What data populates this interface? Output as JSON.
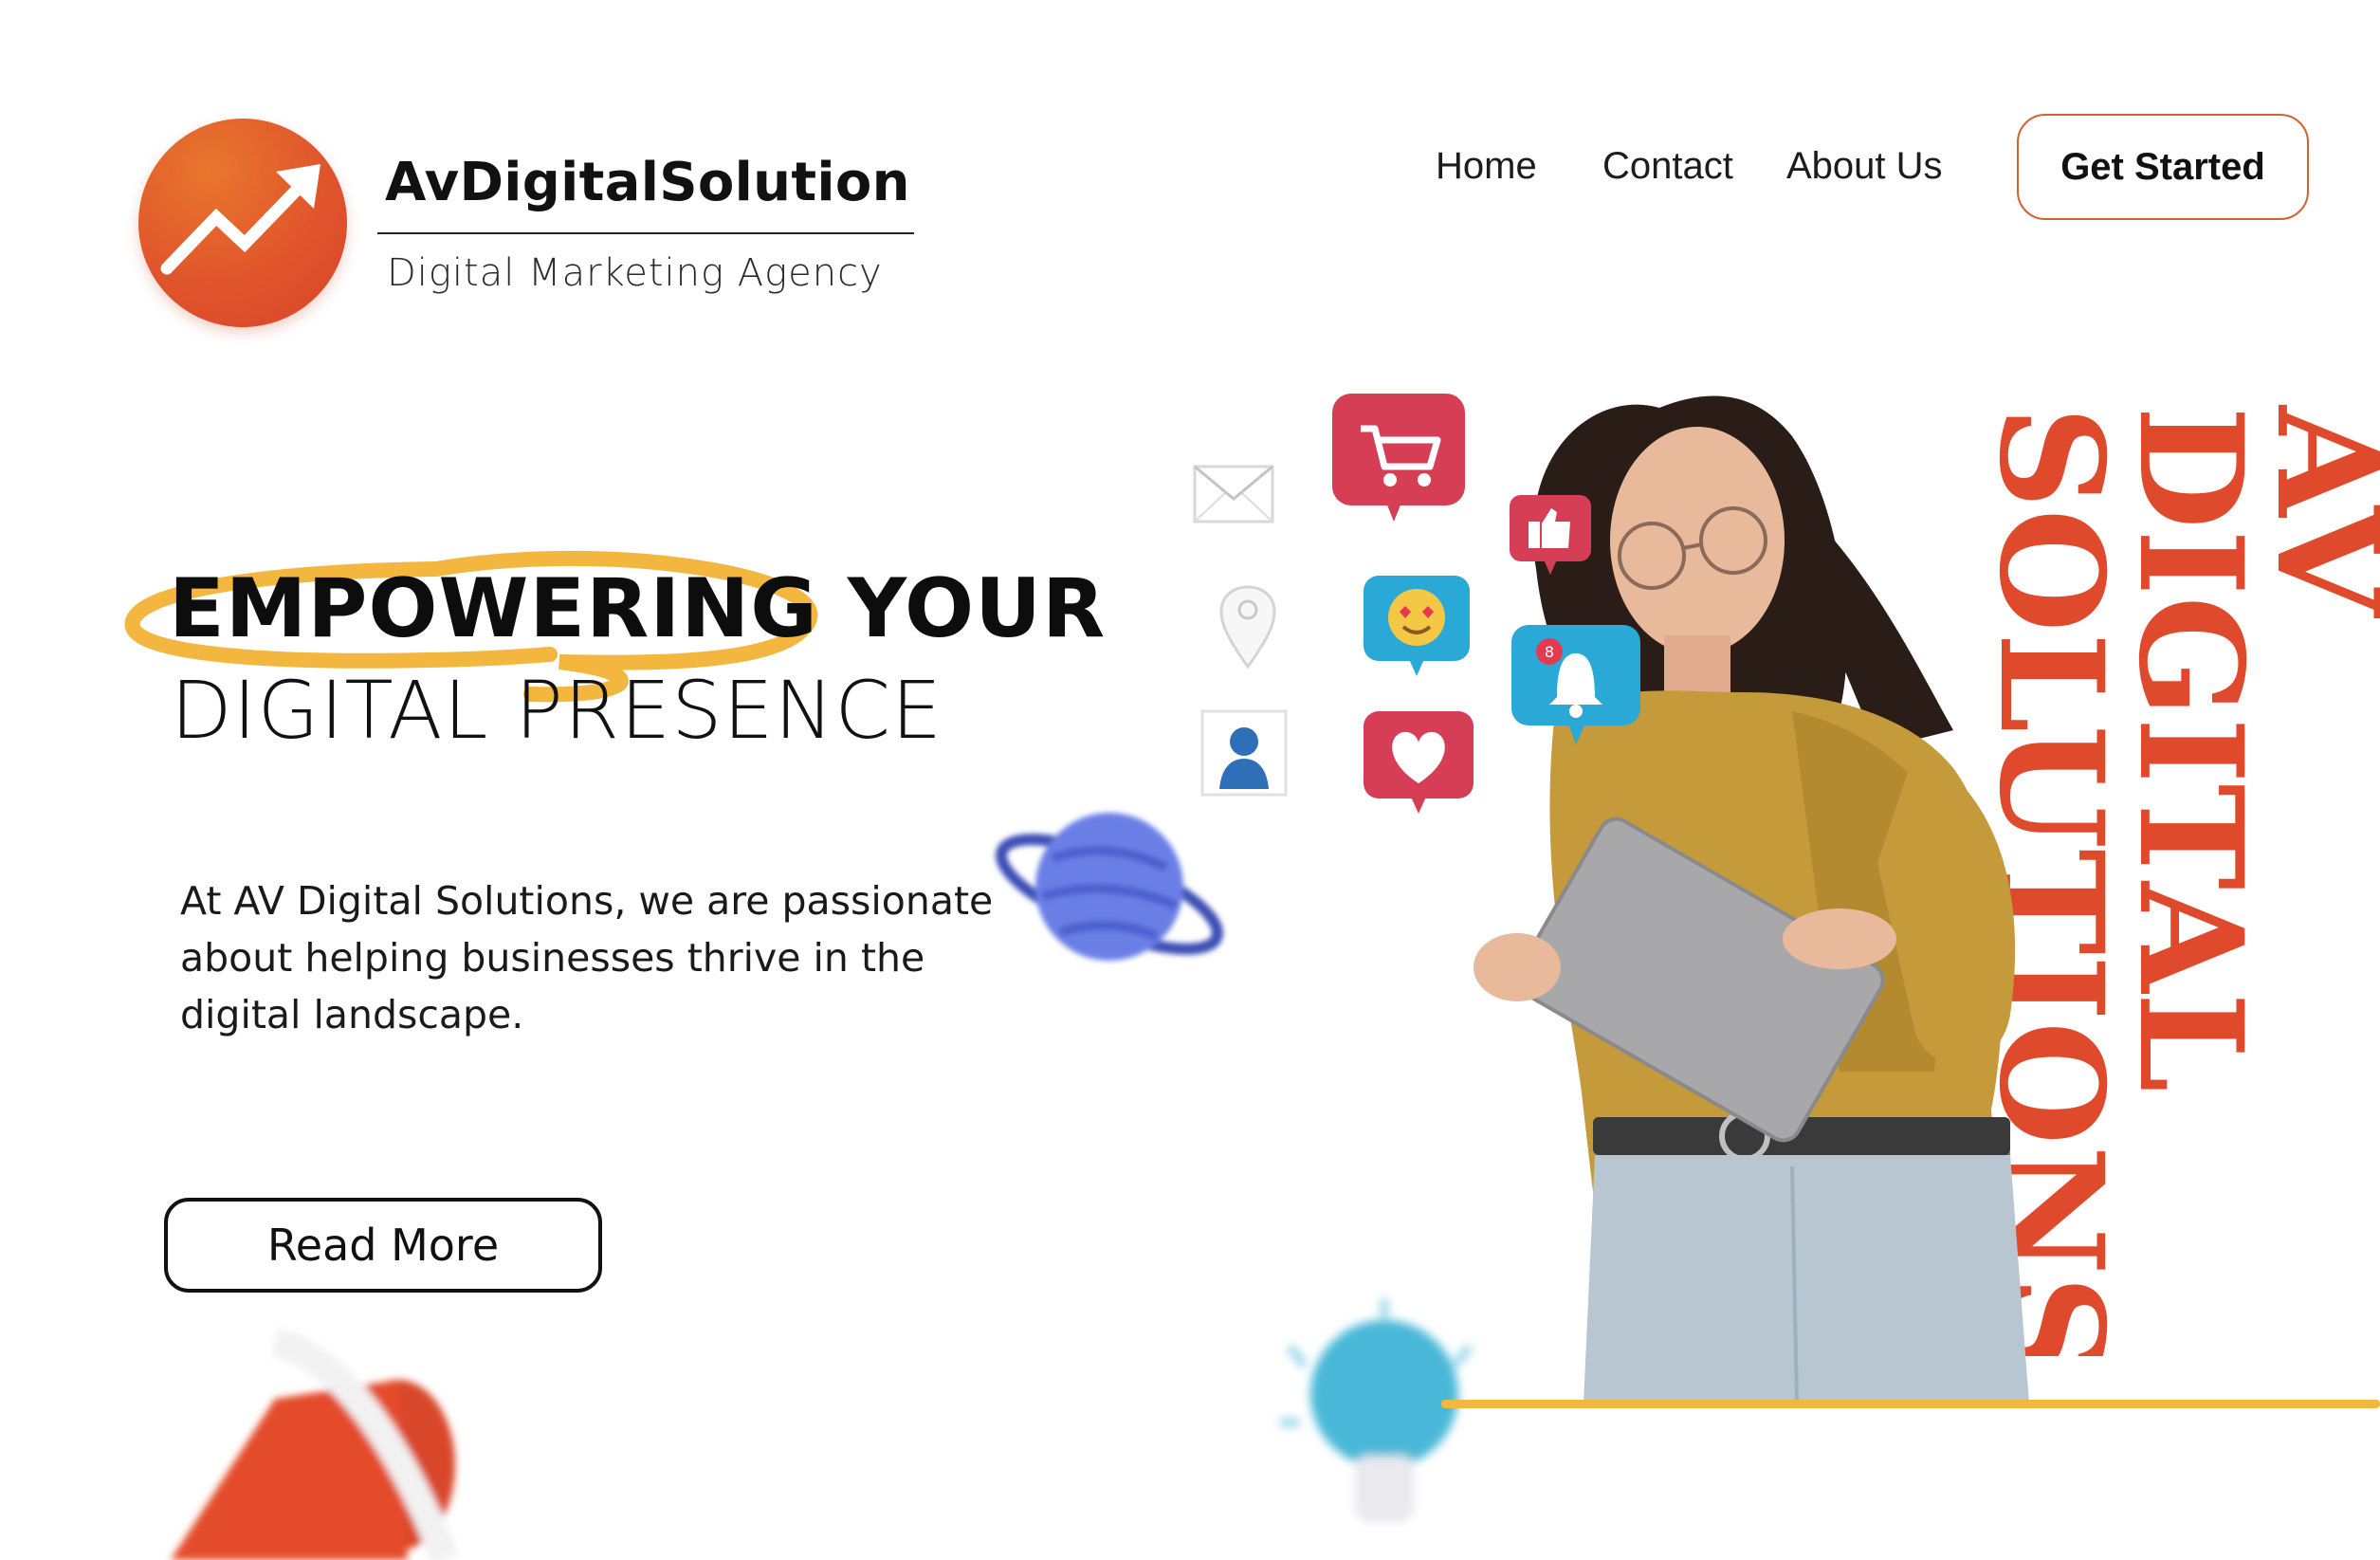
{
  "brand": {
    "name": "AvDigitalSolution",
    "tagline": "Digital Marketing Agency",
    "logo_icon": "trend-up-arrow-icon"
  },
  "nav": {
    "items": [
      {
        "label": "Home"
      },
      {
        "label": "Contact"
      },
      {
        "label": "About Us"
      }
    ],
    "cta_label": "Get Started"
  },
  "hero": {
    "headline_line1": "EMPOWERING YOUR",
    "headline_line2": "DIGITAL PRESENCE",
    "body": "At AV Digital Solutions, we are passionate about helping businesses thrive in the digital landscape.",
    "button_label": "Read More"
  },
  "vertical_text": {
    "line1": "AV",
    "line2": "DIGITAL",
    "line3": "SOLUTIONS"
  },
  "social_icons": {
    "cart": "shopping-cart-icon",
    "like": "thumbs-up-icon",
    "emoji": "heart-eyes-emoji-icon",
    "notification": "bell-icon",
    "notification_count": "8",
    "heart": "heart-icon",
    "mail": "envelope-icon",
    "location": "location-pin-icon",
    "user": "user-icon"
  },
  "colors": {
    "brand_orange": "#e0552c",
    "accent_red": "#df4a2d",
    "accent_yellow": "#f3b63f",
    "cta_border": "#d4612f"
  }
}
